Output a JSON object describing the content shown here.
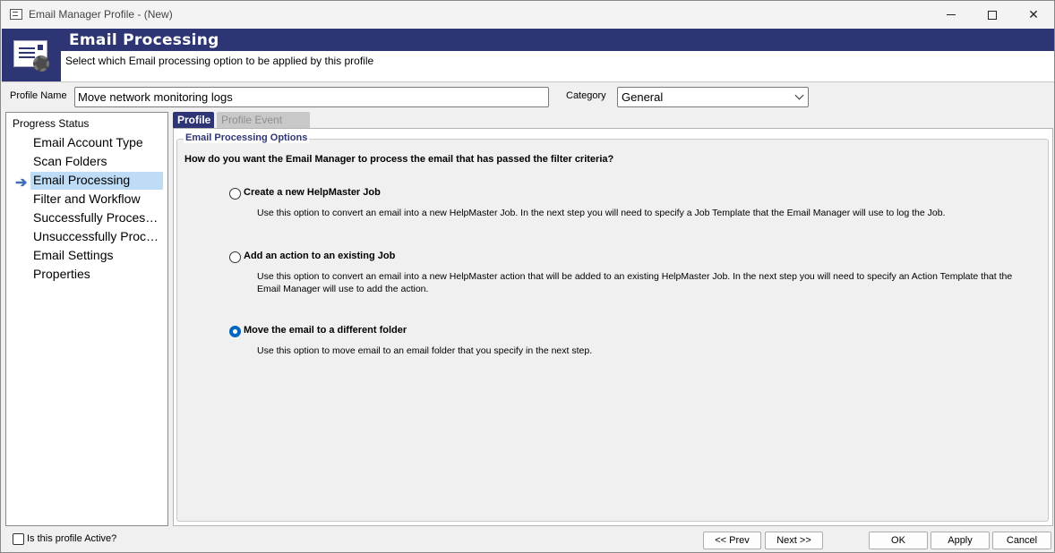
{
  "window": {
    "title": "Email Manager Profile - (New)"
  },
  "banner": {
    "title": "Email Processing",
    "subtitle": "Select which Email processing option to be applied by this profile"
  },
  "form": {
    "profile_name_label": "Profile Name",
    "profile_name_value": "Move network monitoring logs",
    "category_label": "Category",
    "category_value": "General"
  },
  "progress": {
    "header": "Progress Status",
    "steps": [
      "Email Account Type",
      "Scan Folders",
      "Email Processing",
      "Filter and Workflow",
      "Successfully Processed",
      "Unsuccessfully Processed",
      "Email Settings",
      "Properties"
    ],
    "active_index": 2
  },
  "tabs": {
    "profile": "Profile",
    "logs": "Profile Event Logs"
  },
  "options": {
    "group_title": "Email Processing Options",
    "question": "How do  you want the Email Manager to process the email that has passed the filter criteria?",
    "items": [
      {
        "label": "Create a new HelpMaster Job",
        "desc": "Use this option to convert an email into a new HelpMaster Job.  In the next step you will need to specify a Job Template that the Email Manager will use to log the Job.",
        "selected": false
      },
      {
        "label": "Add an action to an existing Job",
        "desc": "Use this option to convert an email into a new HelpMaster action that will be added to an existing HelpMaster Job.  In the next step you will need to specify an Action Template that the Email Manager will use to add the action.",
        "selected": false
      },
      {
        "label": "Move the email to a different folder",
        "desc": "Use this option to move email to an email folder that you specify in the next step.",
        "selected": true
      }
    ]
  },
  "footer": {
    "active_label": "Is this profile Active?",
    "prev": "<< Prev",
    "next": "Next >>",
    "ok": "OK",
    "apply": "Apply",
    "cancel": "Cancel"
  },
  "colors": {
    "brand": "#2e3574",
    "selection": "#bfdcf6",
    "radio_accent": "#0067c0"
  }
}
